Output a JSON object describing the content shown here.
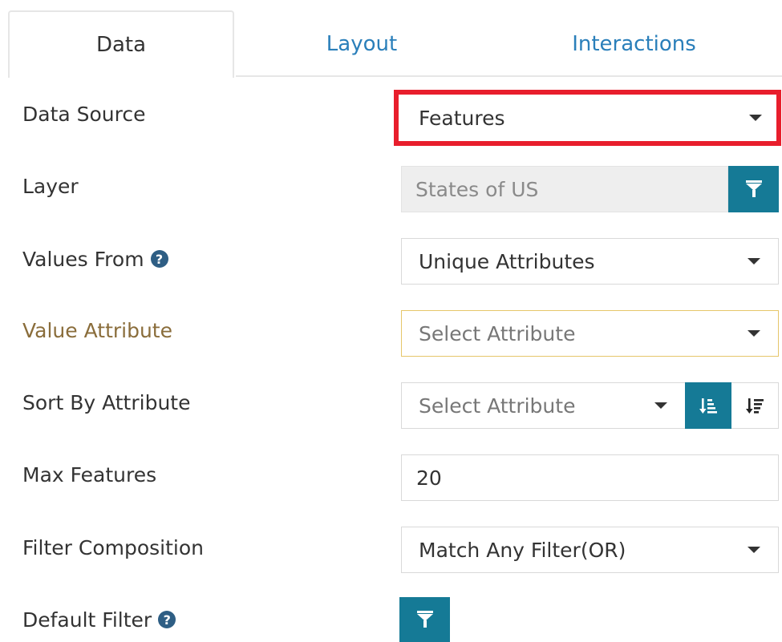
{
  "tabs": [
    {
      "label": "Data",
      "active": true
    },
    {
      "label": "Layout",
      "active": false
    },
    {
      "label": "Interactions",
      "active": false
    }
  ],
  "rows": {
    "data_source": {
      "label": "Data Source",
      "value": "Features"
    },
    "layer": {
      "label": "Layer",
      "value": "States of US"
    },
    "values_from": {
      "label": "Values From",
      "value": "Unique Attributes"
    },
    "value_attribute": {
      "label": "Value Attribute",
      "placeholder": "Select Attribute"
    },
    "sort_by": {
      "label": "Sort By Attribute",
      "placeholder": "Select Attribute"
    },
    "max_features": {
      "label": "Max Features",
      "value": "20"
    },
    "filter_composition": {
      "label": "Filter Composition",
      "value": "Match Any Filter(OR)"
    },
    "default_filter": {
      "label": "Default Filter"
    }
  },
  "help_glyph": "?",
  "colors": {
    "accent": "#157a96",
    "tab_link": "#2a7fba",
    "highlight_border": "#e81e2c",
    "warning_border": "#e6c66a",
    "help_icon": "#2e5e84"
  },
  "icons": [
    "filter-icon",
    "help-icon",
    "caret-down-icon",
    "sort-ascending-icon",
    "sort-descending-icon"
  ]
}
